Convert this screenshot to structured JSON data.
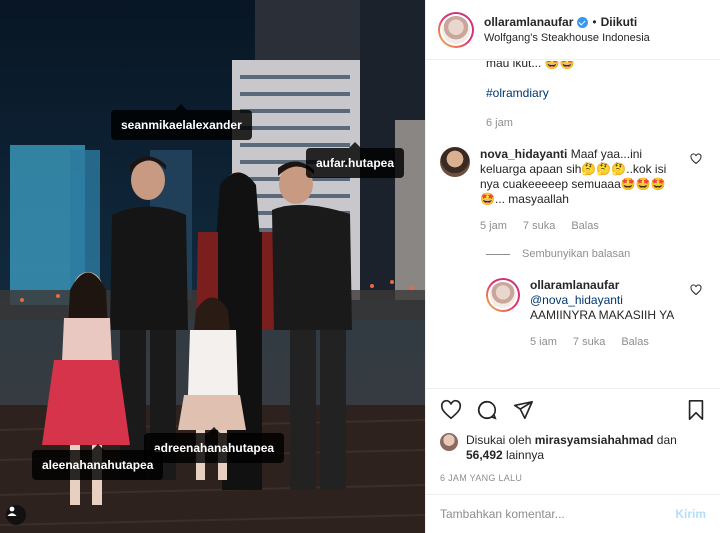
{
  "post": {
    "tags": {
      "tag1": "seanmikaelalexander",
      "tag2": "aufar.hutapea",
      "tag3": "adreenahanahutapea",
      "tag4": "aleenahanahutapea"
    },
    "tag_icon": "user-tag-icon"
  },
  "header": {
    "username": "ollaramlanaufar",
    "verified_icon": "verified-badge-icon",
    "separator": "•",
    "follow_label": "Diikuti",
    "location": "Wolfgang's Steakhouse Indonesia"
  },
  "caption": {
    "tail": "mau ikut... 🤩🤩",
    "hashtag": "#olramdiary",
    "time": "6 jam"
  },
  "comments": [
    {
      "user": "nova_hidayanti",
      "text": "Maaf yaa...ini keluarga apaan sih🤔🤔🤔..kok isi nya cuakeeeeep semuaaa🤩🤩🤩🤩... masyaallah",
      "time": "5 jam",
      "likes": "7 suka",
      "reply": "Balas"
    },
    {
      "user": "ollaramlanaufar",
      "mention": "@nova_hidayanti",
      "text": "AAMIINYRA MAKASIIH YA",
      "time": "5 iam",
      "likes": "7 suka",
      "reply": "Balas"
    }
  ],
  "hide_replies": "Sembunyikan balasan",
  "actions": {
    "like_icon": "heart-icon",
    "comment_icon": "comment-icon",
    "share_icon": "share-icon",
    "save_icon": "bookmark-icon"
  },
  "likes": {
    "prefix": "Disukai oleh",
    "user": "mirasyamsiahahmad",
    "conj": "dan",
    "count": "56,492",
    "suffix": "lainnya"
  },
  "time_ago": "6 JAM YANG LALU",
  "comment_box": {
    "placeholder": "Tambahkan komentar...",
    "post_label": "Kirim"
  },
  "colors": {
    "link": "#00376b",
    "muted": "#8e8e8e",
    "verified": "#3897f0",
    "post_disabled": "#b2dffc"
  }
}
